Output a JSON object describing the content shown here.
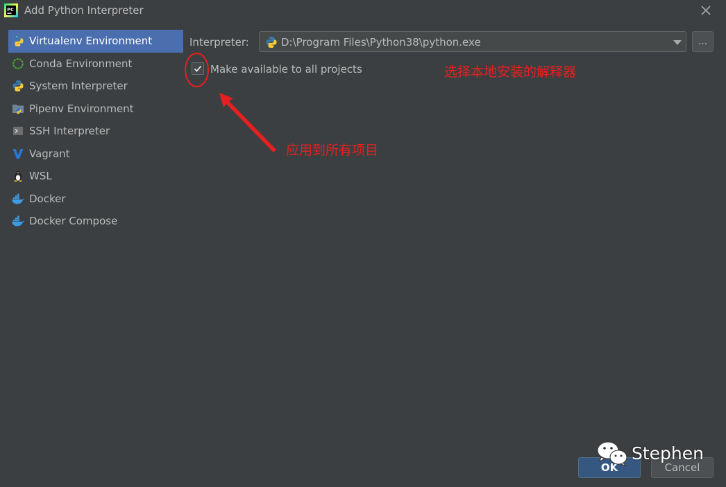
{
  "window": {
    "title": "Add Python Interpreter",
    "app_icon": "pycharm-icon",
    "app_icon_text": "PC"
  },
  "sidebar": {
    "items": [
      {
        "label": "Virtualenv Environment",
        "icon": "python-icon",
        "selected": true
      },
      {
        "label": "Conda Environment",
        "icon": "conda-icon",
        "selected": false
      },
      {
        "label": "System Interpreter",
        "icon": "python-icon",
        "selected": false
      },
      {
        "label": "Pipenv Environment",
        "icon": "pipenv-icon",
        "selected": false
      },
      {
        "label": "SSH Interpreter",
        "icon": "terminal-icon",
        "selected": false
      },
      {
        "label": "Vagrant",
        "icon": "vagrant-icon",
        "selected": false
      },
      {
        "label": "WSL",
        "icon": "linux-penguin-icon",
        "selected": false
      },
      {
        "label": "Docker",
        "icon": "docker-icon",
        "selected": false
      },
      {
        "label": "Docker Compose",
        "icon": "docker-icon",
        "selected": false
      }
    ]
  },
  "main": {
    "interpreter_label": "Interpreter:",
    "interpreter_value": "D:\\Program Files\\Python38\\python.exe",
    "browse_label": "...",
    "make_available_label": "Make available to all projects",
    "make_available_checked": true
  },
  "annotations": {
    "select_local": "选择本地安装的解释器",
    "apply_all": "应用到所有项目"
  },
  "footer": {
    "ok_label": "OK",
    "cancel_label": "Cancel"
  },
  "watermark": {
    "text": "Stephen",
    "icon": "wechat-icon"
  },
  "colors": {
    "background": "#3c3f41",
    "selected": "#4b6eaf",
    "annotation": "#e52020",
    "ok_button": "#365880"
  }
}
